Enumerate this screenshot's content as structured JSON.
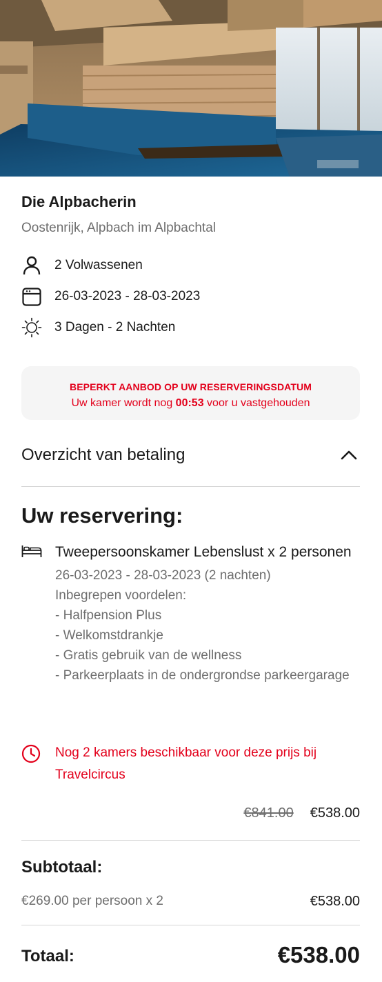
{
  "hotel": {
    "name": "Die Alpbacherin",
    "location": "Oostenrijk, Alpbach im Alpbachtal"
  },
  "details": {
    "guests": "2 Volwassenen",
    "dates": "26-03-2023 - 28-03-2023",
    "duration": "3 Dagen - 2 Nachten"
  },
  "offer": {
    "title": "BEPERKT AANBOD OP UW RESERVERINGSDATUM",
    "text_before": "Uw kamer wordt nog ",
    "timer": "00:53",
    "text_after": " voor u vastgehouden"
  },
  "overview": {
    "title": "Overzicht van betaling"
  },
  "reservation": {
    "title": "Uw reservering:",
    "room_name": "Tweepersoonskamer Lebenslust x 2 personen",
    "room_dates": "26-03-2023 - 28-03-2023 (2 nachten)",
    "benefits_header": "Inbegrepen voordelen:",
    "benefits": [
      "- Halfpension Plus",
      "- Welkomstdrankje",
      "- Gratis gebruik van de wellness",
      "- Parkeerplaats in de ondergrondse parkeergarage"
    ],
    "availability": "Nog 2 kamers beschikbaar voor deze prijs bij Travelcircus",
    "old_price": "€841.00",
    "new_price": "€538.00"
  },
  "subtotal": {
    "label": "Subtotaal:",
    "detail": "€269.00 per persoon x 2",
    "amount": "€538.00"
  },
  "total": {
    "label": "Totaal:",
    "amount": "€538.00"
  },
  "colors": {
    "accent_red": "#e3001b",
    "text": "#1a1a1a",
    "muted": "#6e6e6e",
    "offer_bg": "#f5f5f5"
  },
  "icons": {
    "guests": "person-icon",
    "dates": "calendar-icon",
    "duration": "sun-icon",
    "room": "bed-icon",
    "availability": "clock-icon",
    "collapse": "chevron-up-icon"
  }
}
